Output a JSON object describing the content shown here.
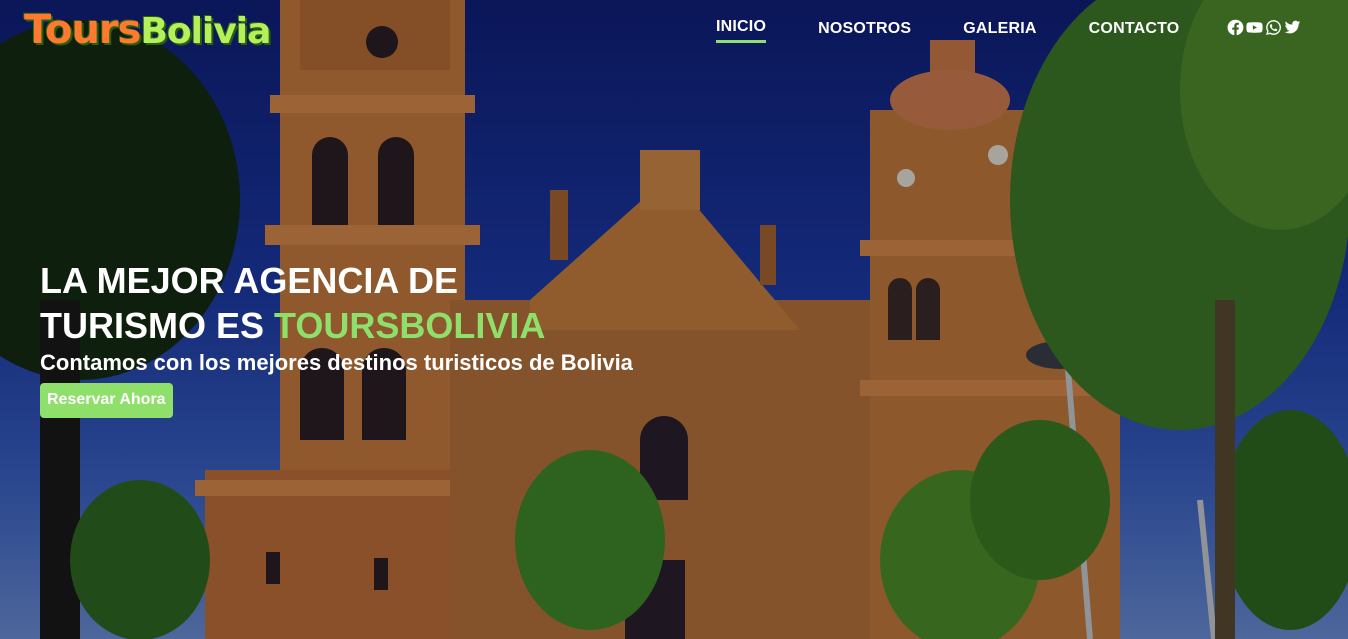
{
  "logo": {
    "part1": "Tours",
    "part2": "Bolivia"
  },
  "nav": {
    "items": [
      {
        "label": "INICIO",
        "active": true
      },
      {
        "label": "NOSOTROS",
        "active": false
      },
      {
        "label": "GALERIA",
        "active": false
      },
      {
        "label": "CONTACTO",
        "active": false
      }
    ],
    "social_icons": [
      "facebook-icon",
      "youtube-icon",
      "whatsapp-icon",
      "twitter-icon"
    ]
  },
  "hero": {
    "title_line1": "LA MEJOR AGENCIA DE",
    "title_line2_prefix": "TURISMO ES ",
    "title_line2_accent": "TOURSBOLIVIA",
    "subtitle": "Contamos con los mejores destinos turisticos de Bolivia",
    "cta_label": "Reservar Ahora"
  },
  "colors": {
    "accent": "#8ee06b",
    "logo_orange": "#ff7a2e",
    "logo_green": "#b4f05a"
  }
}
